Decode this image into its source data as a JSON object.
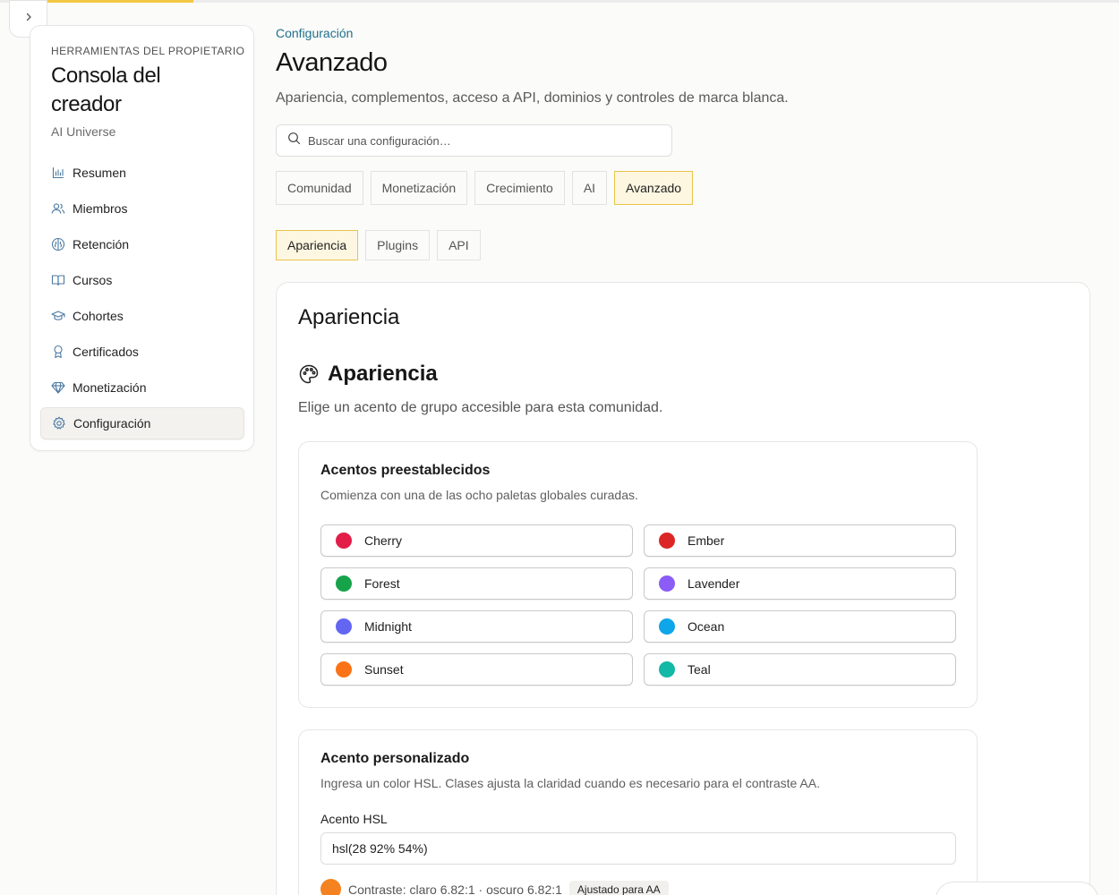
{
  "sidebar": {
    "eyebrow": "HERRAMIENTAS DEL PROPIETARIO",
    "title": "Consola del creador",
    "subtitle": "AI Universe",
    "items": [
      {
        "label": "Resumen",
        "icon": "bar-chart-icon"
      },
      {
        "label": "Miembros",
        "icon": "users-icon"
      },
      {
        "label": "Retención",
        "icon": "brain-icon"
      },
      {
        "label": "Cursos",
        "icon": "book-open-icon"
      },
      {
        "label": "Cohortes",
        "icon": "graduation-cap-icon"
      },
      {
        "label": "Certificados",
        "icon": "award-icon"
      },
      {
        "label": "Monetización",
        "icon": "gem-icon"
      },
      {
        "label": "Configuración",
        "icon": "gear-icon",
        "active": true
      }
    ]
  },
  "header": {
    "breadcrumb": "Configuración",
    "title": "Avanzado",
    "description": "Apariencia, complementos, acceso a API, dominios y controles de marca blanca."
  },
  "search": {
    "placeholder": "Buscar una configuración…",
    "value": ""
  },
  "tabs": [
    {
      "label": "Comunidad",
      "active": false
    },
    {
      "label": "Monetización",
      "active": false
    },
    {
      "label": "Crecimiento",
      "active": false
    },
    {
      "label": "AI",
      "active": false
    },
    {
      "label": "Avanzado",
      "active": true
    }
  ],
  "subtabs": [
    {
      "label": "Apariencia",
      "active": true
    },
    {
      "label": "Plugins",
      "active": false
    },
    {
      "label": "API",
      "active": false
    }
  ],
  "appearance": {
    "card_title": "Apariencia",
    "section_title": "Apariencia",
    "section_icon": "palette-icon",
    "section_description": "Elige un acento de grupo accesible para esta comunidad.",
    "presets": {
      "title": "Acentos preestablecidos",
      "description": "Comienza con una de las ocho paletas globales curadas.",
      "items": [
        {
          "label": "Cherry",
          "color": "#e11d48"
        },
        {
          "label": "Ember",
          "color": "#dc2626"
        },
        {
          "label": "Forest",
          "color": "#16a34a"
        },
        {
          "label": "Lavender",
          "color": "#8b5cf6"
        },
        {
          "label": "Midnight",
          "color": "#6366f1"
        },
        {
          "label": "Ocean",
          "color": "#0ea5e9"
        },
        {
          "label": "Sunset",
          "color": "#f97316"
        },
        {
          "label": "Teal",
          "color": "#14b8a6"
        }
      ]
    },
    "custom": {
      "title": "Acento personalizado",
      "description": "Ingresa un color HSL. Clases ajusta la claridad cuando es necesario para el contraste AA.",
      "label": "Acento HSL",
      "value": "hsl(28 92% 54%)",
      "swatch_color": "#f58220",
      "contrast_text": "Contraste: claro 6.82:1 · oscuro 6.82:1",
      "badge": "Ajustado para AA"
    }
  },
  "colors": {
    "accent_yellow": "#e9c44c",
    "accent_yellow_bg": "#fdf7e1",
    "link": "#1f6f8b"
  }
}
